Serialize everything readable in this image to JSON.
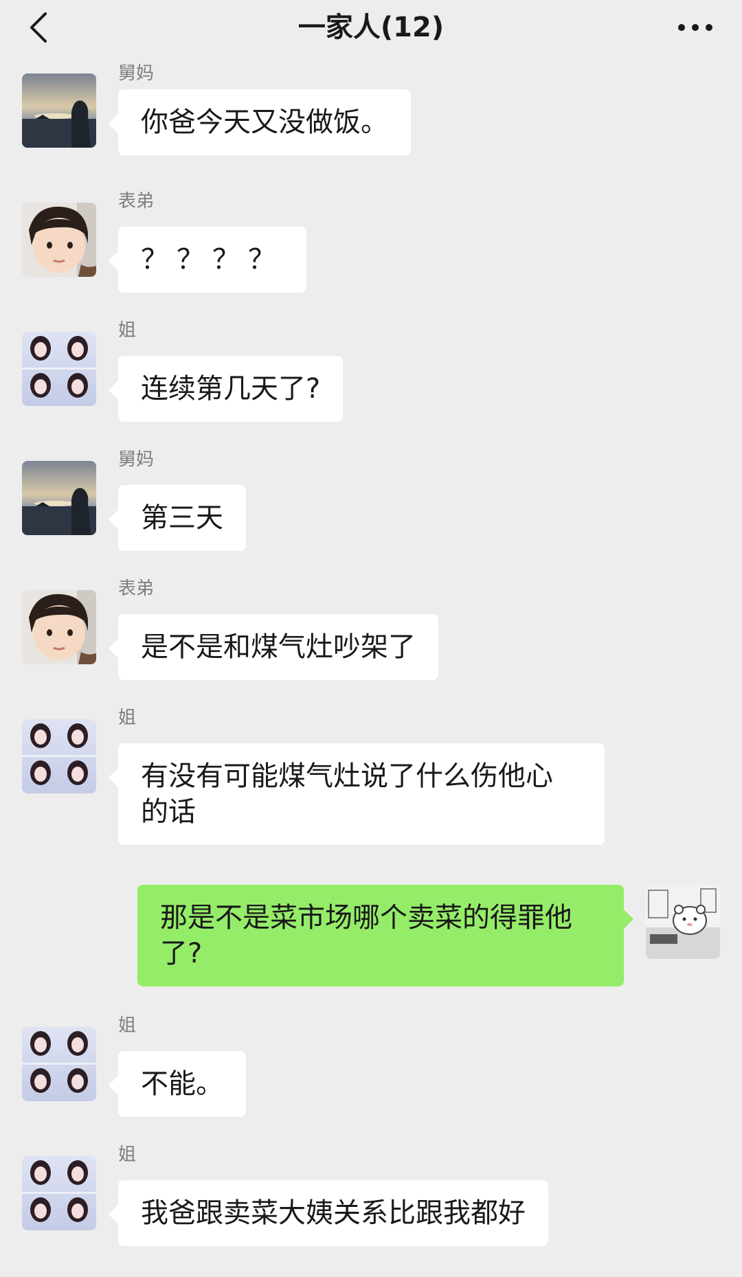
{
  "header": {
    "title": "一家人(12)",
    "back_icon": "chevron-left-icon",
    "more_icon": "more-horizontal-icon"
  },
  "messages": [
    {
      "sender": "舅妈",
      "text": "你爸今天又没做饭。",
      "avatar": "sunset-avatar"
    },
    {
      "sender": "表弟",
      "text": "？？？？",
      "avatar": "child-avatar"
    },
    {
      "sender": "姐",
      "text": "连续第几天了?",
      "avatar": "girl-grid-avatar"
    },
    {
      "sender": "舅妈",
      "text": "第三天",
      "avatar": "sunset-avatar"
    },
    {
      "sender": "表弟",
      "text": "是不是和煤气灶吵架了",
      "avatar": "child-avatar"
    },
    {
      "sender": "姐",
      "text_line1": "有没有可能煤气灶说了什么伤他心",
      "text_line2": "的话",
      "avatar": "girl-grid-avatar"
    },
    {
      "self": true,
      "text_line1": "那是不是菜市场哪个卖菜的得罪他",
      "text_line2": "了?",
      "avatar": "cartoon-bear-avatar"
    },
    {
      "sender": "姐",
      "text": "不能。",
      "avatar": "girl-grid-avatar"
    },
    {
      "sender": "姐",
      "text": "我爸跟卖菜大姨关系比跟我都好",
      "avatar": "girl-grid-avatar"
    }
  ],
  "colors": {
    "background": "#ededed",
    "bubble_incoming": "#ffffff",
    "bubble_outgoing": "#95ec69",
    "sender_name": "#7d7d7d"
  }
}
